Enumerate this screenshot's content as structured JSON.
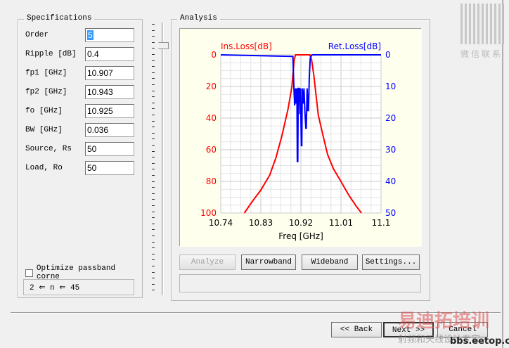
{
  "specs": {
    "title": "Specifications",
    "fields": [
      {
        "label": "Order",
        "value": "5"
      },
      {
        "label": "Ripple [dB]",
        "value": "0.4"
      },
      {
        "label": "fp1 [GHz]",
        "value": "10.907"
      },
      {
        "label": "fp2 [GHz]",
        "value": "10.943"
      },
      {
        "label": "fo [GHz]",
        "value": "10.925"
      },
      {
        "label": "BW [GHz]",
        "value": "0.036"
      },
      {
        "label": "Source, Rs",
        "value": "50"
      },
      {
        "label": "Load, Ro",
        "value": "50"
      }
    ],
    "optimize_label": "Optimize passband corne",
    "optimize_checked": false,
    "range_hint": "2 ⇐ n ⇐ 45"
  },
  "analysis": {
    "title": "Analysis",
    "buttons": {
      "analyze": "Analyze",
      "narrowband": "Narrowband",
      "wideband": "Wideband",
      "settings": "Settings..."
    },
    "status": ""
  },
  "nav": {
    "back": "<< Back",
    "next": "Next >>",
    "cancel": "Cancel"
  },
  "watermark": {
    "qr_caption": "微信联系",
    "brand": "易迪拓培训",
    "sub": "射频和天线设计专家",
    "url": "bbs.eetop.cn"
  },
  "colors": {
    "il": "#ff0000",
    "rl": "#0000ff",
    "plot_bg": "#ffffee"
  },
  "chart_data": {
    "type": "line",
    "xlabel": "Freq [GHz]",
    "ylabel_left": "Ins.Loss[dB]",
    "ylabel_right": "Ret.Loss[dB]",
    "xlim": [
      10.74,
      11.1
    ],
    "ylim_left": [
      0,
      100
    ],
    "ylim_right": [
      0,
      50
    ],
    "xticks": [
      "10.74",
      "10.83",
      "10.92",
      "11.01",
      "11.1"
    ],
    "yticks_left": [
      "0",
      "20",
      "40",
      "60",
      "80",
      "100"
    ],
    "yticks_right": [
      "0",
      "10",
      "20",
      "30",
      "40",
      "50"
    ],
    "grid": true,
    "series": [
      {
        "name": "Ins.Loss[dB]",
        "axis": "left",
        "x": [
          10.793,
          10.81,
          10.83,
          10.85,
          10.864,
          10.877,
          10.891,
          10.8997,
          10.905,
          10.908,
          10.94,
          10.944,
          10.949,
          10.959,
          10.97,
          10.98,
          10.993,
          11.009,
          11.027,
          11.045,
          11.056
        ],
        "y": [
          100,
          93,
          85.5,
          76,
          65,
          51.5,
          34.5,
          20.5,
          3,
          0,
          0,
          3,
          13,
          38,
          51.5,
          63,
          72,
          79.6,
          88.5,
          96,
          100
        ]
      },
      {
        "name": "Ret.Loss[dB]",
        "axis": "right",
        "x": [
          10.74,
          10.902,
          10.904,
          10.906,
          10.908,
          10.909,
          10.911,
          10.912,
          10.913,
          10.914,
          10.916,
          10.918,
          10.919,
          10.921,
          10.922,
          10.923,
          10.925,
          10.927,
          10.929,
          10.931,
          10.932,
          10.934,
          10.936,
          10.937,
          10.939,
          10.941,
          10.943,
          10.945,
          11.1
        ],
        "y": [
          0,
          0.5,
          9.5,
          16,
          10.6,
          15.4,
          10.6,
          33.7,
          33.7,
          10.6,
          10.6,
          18.7,
          10.6,
          28.7,
          28.7,
          10.6,
          15.4,
          10.6,
          18,
          23.2,
          23.2,
          10.6,
          17.6,
          17.6,
          6.6,
          1,
          0.5,
          0,
          0
        ]
      }
    ]
  }
}
